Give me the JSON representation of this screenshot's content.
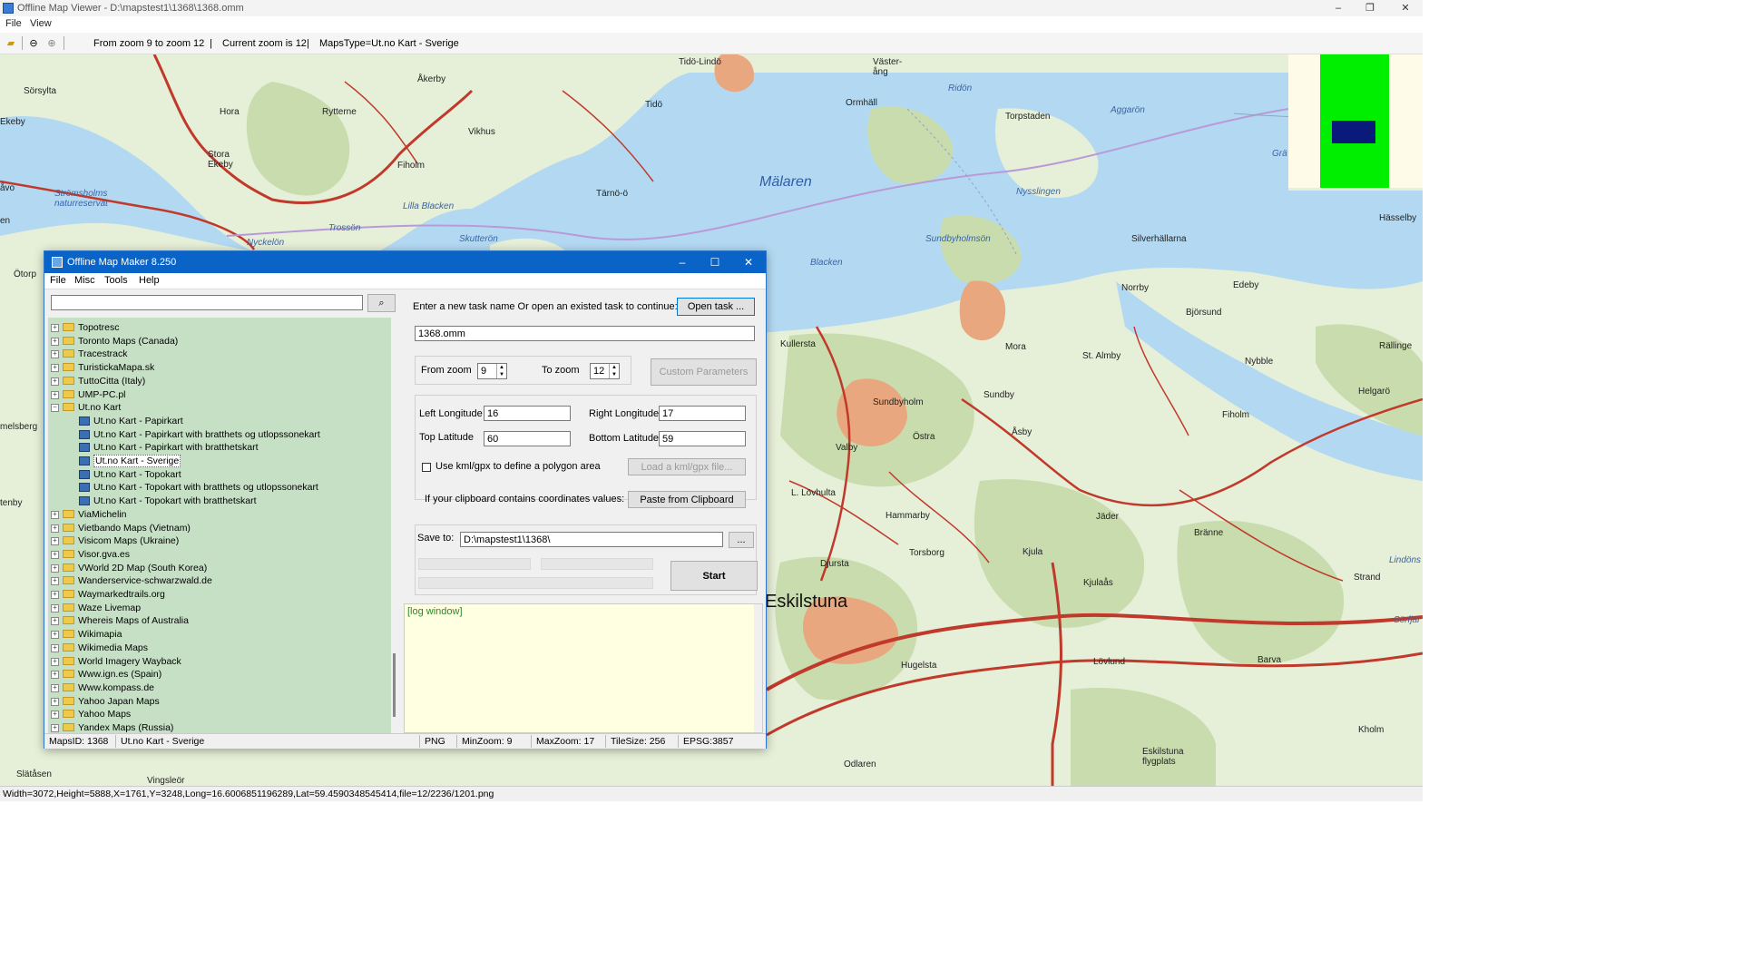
{
  "viewer": {
    "title": "Offline Map Viewer - D:\\mapstest1\\1368\\1368.omm",
    "menu": [
      "File",
      "View"
    ],
    "toolbar": {
      "zoom_range": "From zoom 9 to zoom 12",
      "current_zoom": "Current zoom is 12",
      "maps_type": "MapsType=Ut.no Kart - Sverige"
    },
    "status": "Width=3072,Height=5888,X=1761,Y=3248,Long=16.6006851196289,Lat=59.4590348545414,file=12/2236/1201.png",
    "icons": [
      "open-folder-icon",
      "zoom-out-icon",
      "zoom-in-icon"
    ]
  },
  "map": {
    "colors": {
      "land": "#e6efd8",
      "water": "#b3d9f2",
      "forest": "#c8dcae",
      "road": "#c0392b",
      "urban": "#e8a77e"
    },
    "labels": {
      "malaren": "Mälaren",
      "eskilstuna": "Eskilstuna",
      "sorsylta": "Sörsylta",
      "hora": "Hora",
      "rytterne": "Rytterne",
      "akerby": "Åkerby",
      "tidolindo": "Tidö-Lindö",
      "tido": "Tidö",
      "vasterang": "Väster-\nång",
      "ridon": "Ridön",
      "ormhall": "Ormhäll",
      "torpstaden": "Torpstaden",
      "aggaron": "Aggarön",
      "vikhus": "Vikhus",
      "storaekeby": "Stora\nEkeby",
      "filholm": "Fiholm",
      "tarnoo": "Tärnö-ö",
      "stromsholms": "Strömsholms\nnaturreservat",
      "lillablacken": "Lilla Blacken",
      "trosson": "Trossön",
      "skutteron": "Skutterön",
      "nyckelon": "Nyckelön",
      "blacken": "Blacken",
      "sundbyholmson": "Sundbyholmsön",
      "nysslingen": "Nysslingen",
      "silverhallarna": "Silverhällarna",
      "norrby": "Norrby",
      "edeby": "Edeby",
      "bjorsund": "Björsund",
      "rallinge": "Rällinge",
      "nybble": "Nybble",
      "kullersta": "Kullersta",
      "mora": "Mora",
      "stalmby": "St. Almby",
      "sundbyholm": "Sundbyholm",
      "sundby": "Sundby",
      "helgaro": "Helgarö",
      "fiholm": "Fiholm",
      "valby": "Valby",
      "ostra": "Östra",
      "asby": "Åsby",
      "llovhulta": "L. Lövhulta",
      "hammarby": "Hammarby",
      "jader": "Jäder",
      "branne": "Bränne",
      "torsborg": "Torsborg",
      "djursta": "Djursta",
      "kjula": "Kjula",
      "kjulaas": "Kjulaås",
      "strand": "Strand",
      "hugelsta": "Hugelsta",
      "lovlund": "Lövlund",
      "barva": "Barva",
      "eskilstunaflyg": "Eskilstuna\nflygplats",
      "odlaren": "Odlaren",
      "kholm": "Kholm",
      "slatasen": "Slätåsen",
      "vingsleor": "Vingsleör",
      "hasselby": "Hässelby",
      "sorfjar": "Sörfjär",
      "lindons": "Lindöns",
      "ekeby": "Ekeby",
      "avo": "åvo",
      "en": "en",
      "otorp": "Ötorp",
      "melsberg": "melsberg",
      "tenby": "tenby",
      "grav": "Grä"
    }
  },
  "dialog": {
    "title": "Offline Map Maker 8.250",
    "menu": [
      "File",
      "Misc",
      "Tools",
      "Help"
    ],
    "search_value": "",
    "tree": [
      {
        "label": "Topotresc",
        "type": "folder",
        "level": 0
      },
      {
        "label": "Toronto Maps (Canada)",
        "type": "folder",
        "level": 0
      },
      {
        "label": "Tracestrack",
        "type": "folder",
        "level": 0
      },
      {
        "label": "TuristickaMapa.sk",
        "type": "folder",
        "level": 0
      },
      {
        "label": "TuttoCitta (Italy)",
        "type": "folder",
        "level": 0
      },
      {
        "label": "UMP-PC.pl",
        "type": "folder",
        "level": 0
      },
      {
        "label": "Ut.no Kart",
        "type": "folder-open",
        "level": 0
      },
      {
        "label": "Ut.no Kart - Papirkart",
        "type": "map",
        "level": 1
      },
      {
        "label": "Ut.no Kart - Papirkart with bratthets og utlopssonekart",
        "type": "map",
        "level": 1
      },
      {
        "label": "Ut.no Kart - Papirkart with bratthetskart",
        "type": "map",
        "level": 1
      },
      {
        "label": "Ut.no Kart - Sverige",
        "type": "map",
        "level": 1,
        "selected": true
      },
      {
        "label": "Ut.no Kart - Topokart",
        "type": "map",
        "level": 1
      },
      {
        "label": "Ut.no Kart - Topokart with bratthets og utlopssonekart",
        "type": "map",
        "level": 1
      },
      {
        "label": "Ut.no Kart - Topokart with bratthetskart",
        "type": "map",
        "level": 1
      },
      {
        "label": "ViaMichelin",
        "type": "folder",
        "level": 0
      },
      {
        "label": "Vietbando Maps (Vietnam)",
        "type": "folder",
        "level": 0
      },
      {
        "label": "Visicom Maps (Ukraine)",
        "type": "folder",
        "level": 0
      },
      {
        "label": "Visor.gva.es",
        "type": "folder",
        "level": 0
      },
      {
        "label": "VWorld 2D Map (South Korea)",
        "type": "folder",
        "level": 0
      },
      {
        "label": "Wanderservice-schwarzwald.de",
        "type": "folder",
        "level": 0
      },
      {
        "label": "Waymarkedtrails.org",
        "type": "folder",
        "level": 0
      },
      {
        "label": "Waze Livemap",
        "type": "folder",
        "level": 0
      },
      {
        "label": "Whereis Maps of Australia",
        "type": "folder",
        "level": 0
      },
      {
        "label": "Wikimapia",
        "type": "folder",
        "level": 0
      },
      {
        "label": "Wikimedia Maps",
        "type": "folder",
        "level": 0
      },
      {
        "label": "World Imagery Wayback",
        "type": "folder",
        "level": 0
      },
      {
        "label": "Www.ign.es (Spain)",
        "type": "folder",
        "level": 0
      },
      {
        "label": "Www.kompass.de",
        "type": "folder",
        "level": 0
      },
      {
        "label": "Yahoo Japan Maps",
        "type": "folder",
        "level": 0
      },
      {
        "label": "Yahoo Maps",
        "type": "folder",
        "level": 0
      },
      {
        "label": "Yandex Maps (Russia)",
        "type": "folder",
        "level": 0
      }
    ],
    "task_prompt": "Enter a new task name Or open an existed task to continue:",
    "open_task": "Open task ...",
    "task_name": "1368.omm",
    "from_zoom_label": "From zoom",
    "from_zoom": "9",
    "to_zoom_label": "To zoom",
    "to_zoom": "12",
    "custom_params": "Custom Parameters",
    "left_lon_label": "Left Longitude",
    "left_lon": "16",
    "right_lon_label": "Right Longitude",
    "right_lon": "17",
    "top_lat_label": "Top Latitude",
    "top_lat": "60",
    "bottom_lat_label": "Bottom Latitude",
    "bottom_lat": "59",
    "kml_label": "Use kml/gpx to define a polygon area",
    "load_kml": "Load a kml/gpx file...",
    "clipboard_label": "If your clipboard contains coordinates values:",
    "paste_clip": "Paste from Clipboard",
    "save_to_label": "Save to:",
    "save_to": "D:\\mapstest1\\1368\\",
    "browse": "...",
    "start": "Start",
    "log": "[log window]",
    "status": {
      "mapsid": "MapsID: 1368",
      "name": "Ut.no Kart - Sverige",
      "format": "PNG",
      "minzoom": "MinZoom: 9",
      "maxzoom": "MaxZoom: 17",
      "tilesize": "TileSize: 256",
      "epsg": "EPSG:3857"
    }
  }
}
